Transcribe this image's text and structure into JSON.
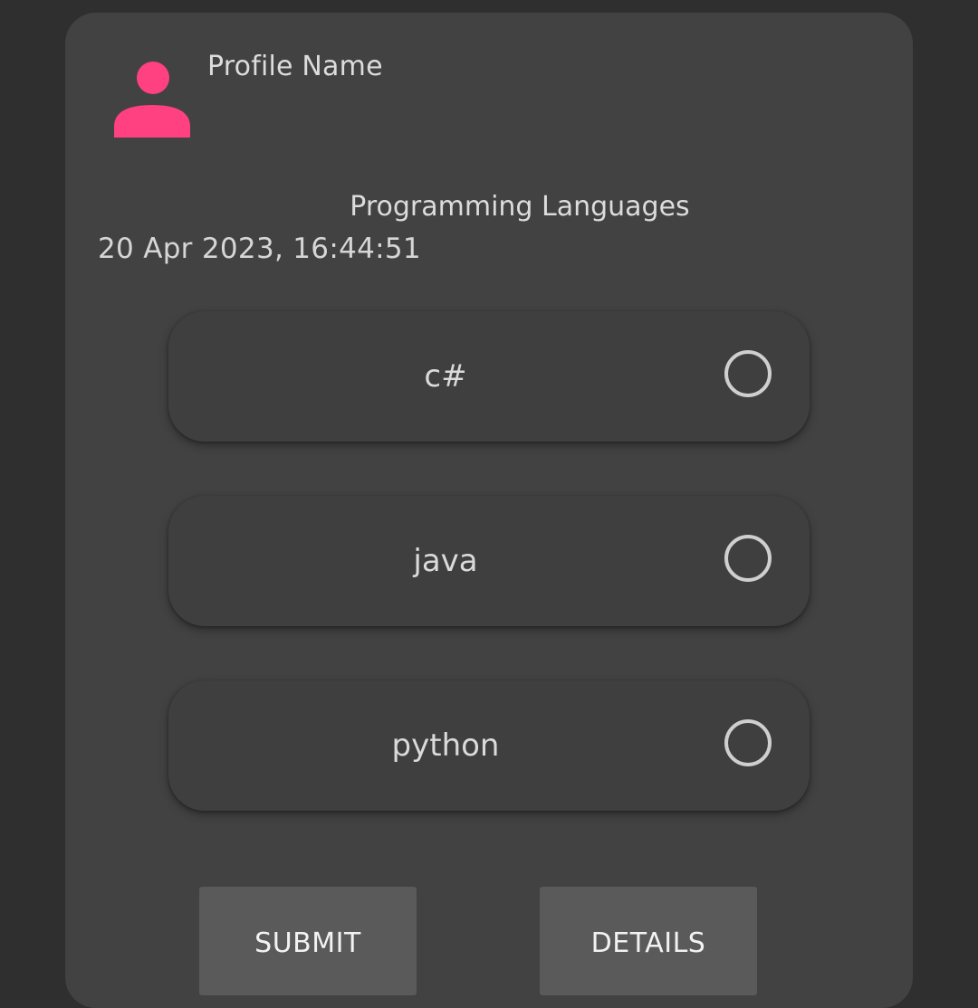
{
  "profile": {
    "name": "Profile Name",
    "avatar_icon": "person-icon",
    "avatar_color": "#ff4081"
  },
  "poll": {
    "title": "Programming Languages",
    "timestamp": "20 Apr 2023, 16:44:51",
    "options": [
      {
        "label": "c#",
        "selected": false
      },
      {
        "label": "java",
        "selected": false
      },
      {
        "label": "python",
        "selected": false
      }
    ]
  },
  "actions": {
    "submit_label": "SUBMIT",
    "details_label": "DETAILS"
  }
}
